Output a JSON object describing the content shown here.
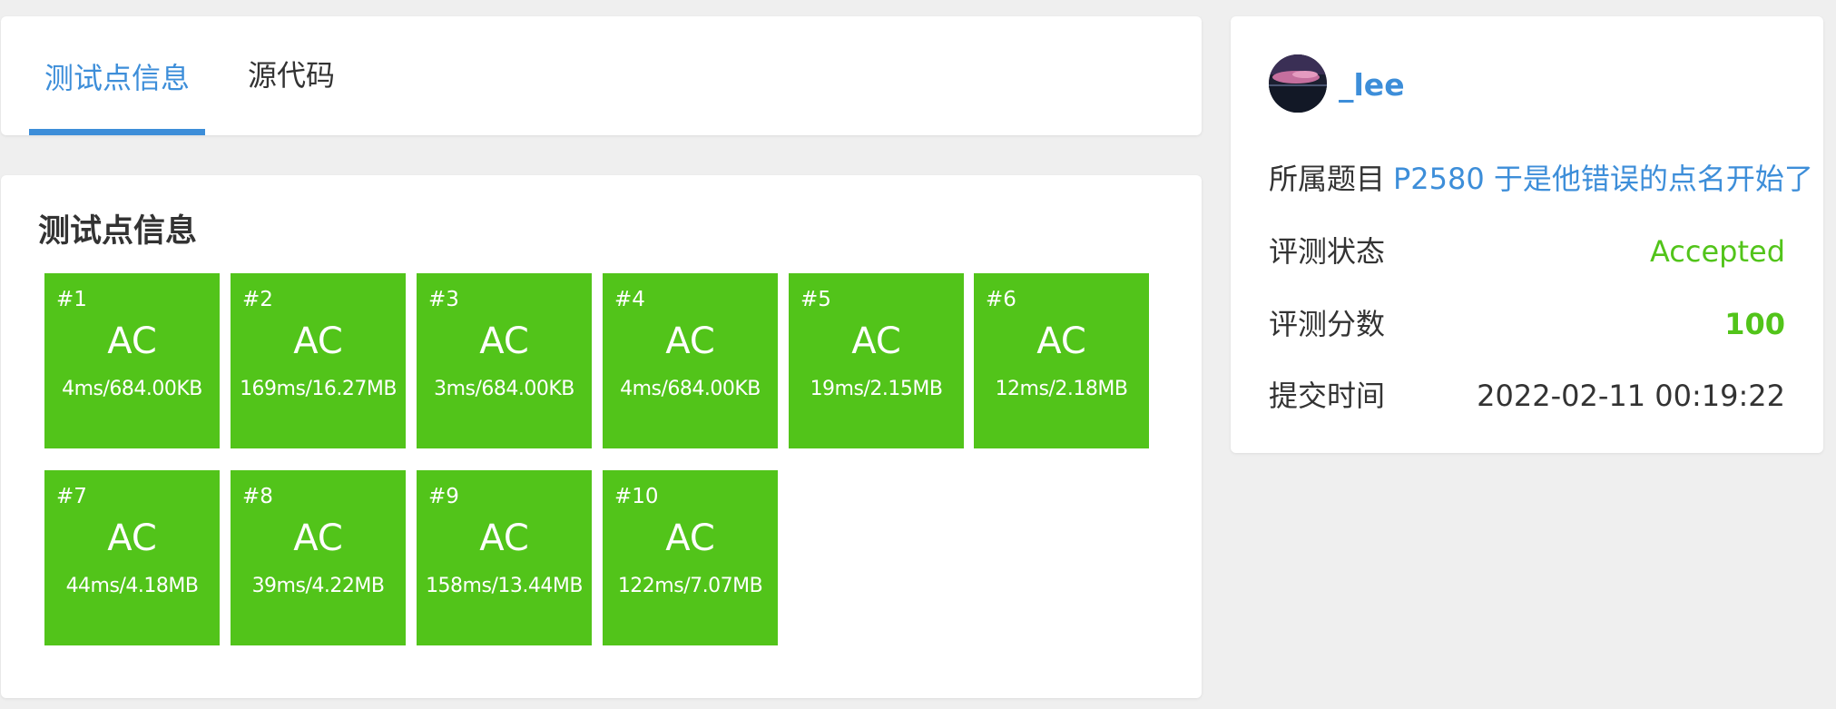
{
  "tabs": [
    {
      "label": "测试点信息"
    },
    {
      "label": "源代码"
    }
  ],
  "tests": {
    "title": "测试点信息",
    "items": [
      {
        "num": "#1",
        "status": "AC",
        "stat": "4ms/684.00KB"
      },
      {
        "num": "#2",
        "status": "AC",
        "stat": "169ms/16.27MB"
      },
      {
        "num": "#3",
        "status": "AC",
        "stat": "3ms/684.00KB"
      },
      {
        "num": "#4",
        "status": "AC",
        "stat": "4ms/684.00KB"
      },
      {
        "num": "#5",
        "status": "AC",
        "stat": "19ms/2.15MB"
      },
      {
        "num": "#6",
        "status": "AC",
        "stat": "12ms/2.18MB"
      },
      {
        "num": "#7",
        "status": "AC",
        "stat": "44ms/4.18MB"
      },
      {
        "num": "#8",
        "status": "AC",
        "stat": "39ms/4.22MB"
      },
      {
        "num": "#9",
        "status": "AC",
        "stat": "158ms/13.44MB"
      },
      {
        "num": "#10",
        "status": "AC",
        "stat": "122ms/7.07MB"
      }
    ]
  },
  "info": {
    "username": "_lee",
    "problem_label": "所属题目",
    "problem_link": "P2580 于是他错误的点名开始了",
    "status_label": "评测状态",
    "status_value": "Accepted",
    "score_label": "评测分数",
    "score_value": "100",
    "time_label": "提交时间",
    "time_value": "2022-02-11 00:19:22"
  },
  "colors": {
    "accent": "#3d8ed9",
    "accepted": "#52c41a",
    "background": "#efefef"
  }
}
